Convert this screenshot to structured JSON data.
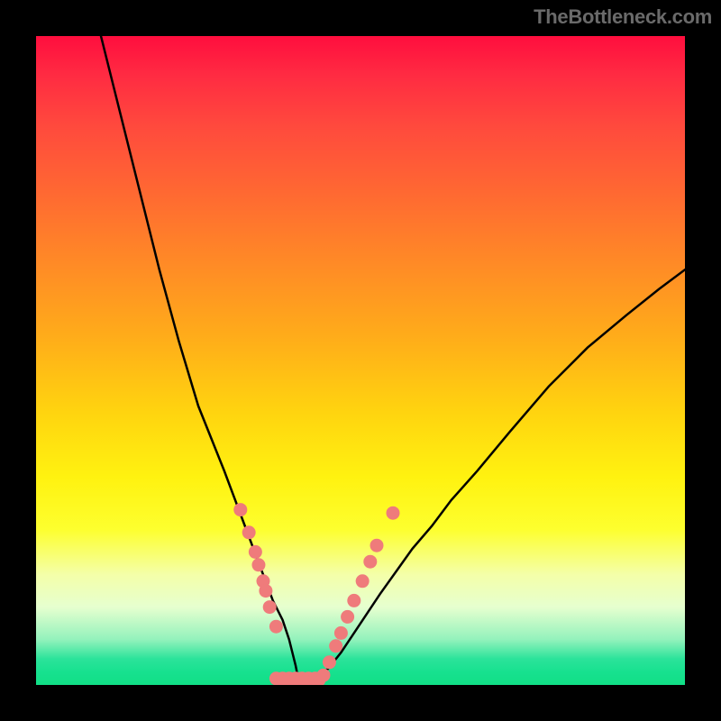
{
  "watermark": "TheBottleneck.com",
  "chart_data": {
    "type": "line",
    "title": "",
    "xlabel": "",
    "ylabel": "",
    "xlim": [
      0,
      100
    ],
    "ylim": [
      0,
      100
    ],
    "note": "No visible axis tick labels or gridlines; values are pixel-position estimates from a 720x720 plot. y is inverted (0 at top).",
    "series": [
      {
        "name": "left-curve",
        "x": [
          10.0,
          13.0,
          16.0,
          19.0,
          22.0,
          25.0,
          27.0,
          29.0,
          30.5,
          32.0,
          33.5,
          35.0,
          36.5,
          38.0,
          39.0,
          39.5,
          40.0,
          40.3,
          40.6,
          41.0
        ],
        "y": [
          0.0,
          12.0,
          24.0,
          36.0,
          47.0,
          57.0,
          62.0,
          67.0,
          71.0,
          75.0,
          79.0,
          83.0,
          87.0,
          90.0,
          93.0,
          95.0,
          97.0,
          98.5,
          99.5,
          100.0
        ]
      },
      {
        "name": "right-curve",
        "x": [
          41.0,
          43.0,
          45.0,
          47.0,
          49.0,
          51.0,
          53.0,
          55.5,
          58.0,
          61.0,
          64.0,
          68.0,
          73.0,
          79.0,
          85.0,
          91.0,
          96.0,
          100.0
        ],
        "y": [
          100.0,
          99.0,
          97.5,
          95.0,
          92.0,
          89.0,
          86.0,
          82.5,
          79.0,
          75.5,
          71.5,
          67.0,
          61.0,
          54.0,
          48.0,
          43.0,
          39.0,
          36.0
        ]
      },
      {
        "name": "floor-trace",
        "x": [
          37.0,
          41.0,
          44.0
        ],
        "y": [
          99.5,
          99.5,
          99.5
        ]
      }
    ],
    "scatter": {
      "name": "pink-dots",
      "color": "#ef7b7b",
      "points": [
        {
          "x": 31.5,
          "y": 73.0
        },
        {
          "x": 32.8,
          "y": 76.5
        },
        {
          "x": 33.8,
          "y": 79.5
        },
        {
          "x": 34.3,
          "y": 81.5
        },
        {
          "x": 35.0,
          "y": 84.0
        },
        {
          "x": 35.4,
          "y": 85.5
        },
        {
          "x": 36.0,
          "y": 88.0
        },
        {
          "x": 37.0,
          "y": 91.0
        },
        {
          "x": 37.0,
          "y": 99.0
        },
        {
          "x": 38.0,
          "y": 99.0
        },
        {
          "x": 39.0,
          "y": 99.0
        },
        {
          "x": 40.0,
          "y": 99.0
        },
        {
          "x": 41.0,
          "y": 99.0
        },
        {
          "x": 42.0,
          "y": 99.0
        },
        {
          "x": 43.0,
          "y": 99.0
        },
        {
          "x": 43.7,
          "y": 99.0
        },
        {
          "x": 44.3,
          "y": 98.5
        },
        {
          "x": 45.2,
          "y": 96.5
        },
        {
          "x": 46.2,
          "y": 94.0
        },
        {
          "x": 47.0,
          "y": 92.0
        },
        {
          "x": 48.0,
          "y": 89.5
        },
        {
          "x": 49.0,
          "y": 87.0
        },
        {
          "x": 50.3,
          "y": 84.0
        },
        {
          "x": 51.5,
          "y": 81.0
        },
        {
          "x": 52.5,
          "y": 78.5
        },
        {
          "x": 55.0,
          "y": 73.5
        }
      ]
    }
  }
}
